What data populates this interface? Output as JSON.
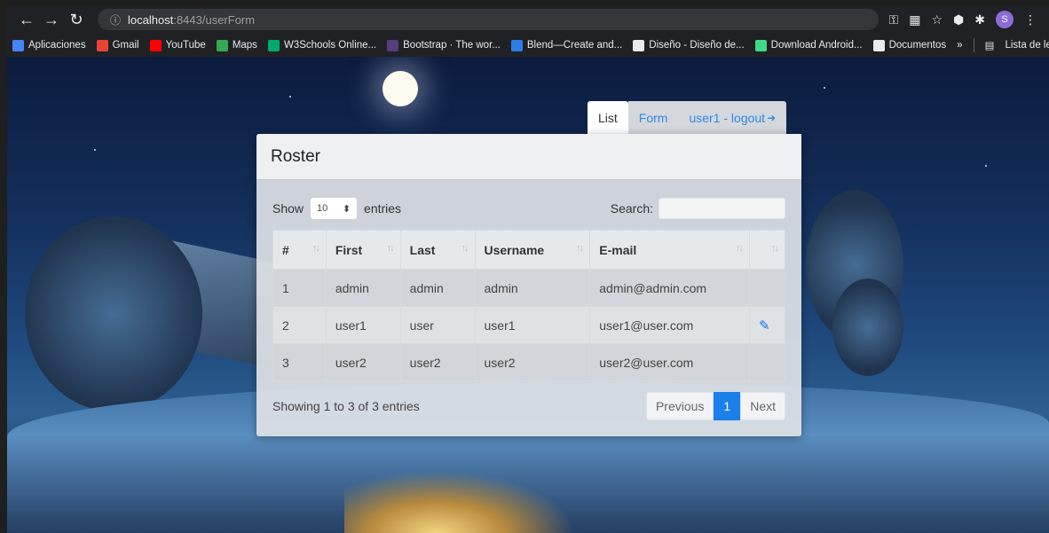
{
  "browser": {
    "url_host": "localhost",
    "url_rest": ":8443/userForm",
    "profile_initial": "S",
    "bookmarks": [
      {
        "label": "Aplicaciones",
        "color": "#4285f4"
      },
      {
        "label": "Gmail",
        "color": "#ea4335"
      },
      {
        "label": "YouTube",
        "color": "#ff0000"
      },
      {
        "label": "Maps",
        "color": "#34a853"
      },
      {
        "label": "W3Schools Online...",
        "color": "#04aa6d"
      },
      {
        "label": "Bootstrap · The wor...",
        "color": "#563d7c"
      },
      {
        "label": "Blend—Create and...",
        "color": "#2b7de9"
      },
      {
        "label": "Diseño - Diseño de...",
        "color": "#e8eaed"
      },
      {
        "label": "Download Android...",
        "color": "#3ddc84"
      },
      {
        "label": "Documentos",
        "color": "#e8eaed"
      }
    ],
    "reading_list": "Lista de lectura",
    "overflow": "»"
  },
  "tabs": {
    "list": "List",
    "form": "Form",
    "logout": "user1 - logout"
  },
  "card": {
    "title": "Roster",
    "show_label": "Show",
    "page_length": "10",
    "entries_label": "entries",
    "search_label": "Search:",
    "columns": [
      "#",
      "First",
      "Last",
      "Username",
      "E-mail",
      ""
    ],
    "rows": [
      {
        "id": "1",
        "first": "admin",
        "last": "admin",
        "username": "admin",
        "email": "admin@admin.com",
        "editable": false
      },
      {
        "id": "2",
        "first": "user1",
        "last": "user",
        "username": "user1",
        "email": "user1@user.com",
        "editable": true
      },
      {
        "id": "3",
        "first": "user2",
        "last": "user2",
        "username": "user2",
        "email": "user2@user.com",
        "editable": false
      }
    ],
    "info": "Showing 1 to 3 of 3 entries",
    "pagination": {
      "previous": "Previous",
      "current": "1",
      "next": "Next"
    }
  },
  "colors": {
    "accent": "#1a7fe8",
    "link": "#2f8ae6"
  }
}
